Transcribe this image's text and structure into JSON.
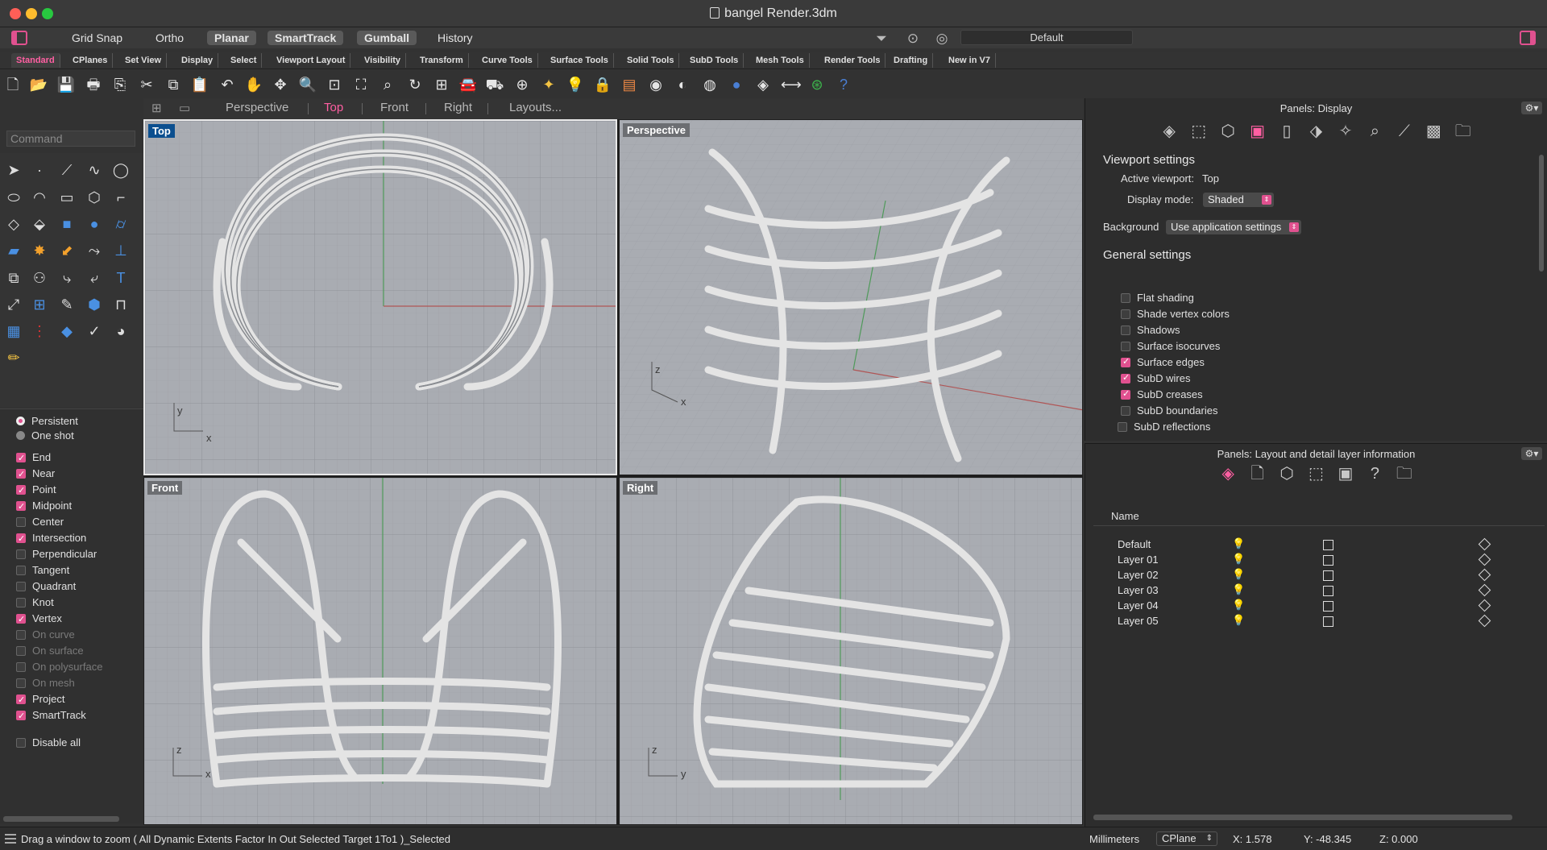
{
  "window": {
    "title": "bangel  Render.3dm"
  },
  "modebar": {
    "buttons": [
      "Grid Snap",
      "Ortho",
      "Planar",
      "SmartTrack",
      "Gumball",
      "History"
    ],
    "default_label": "Default"
  },
  "tabs": [
    "Standard",
    "CPlanes",
    "Set View",
    "Display",
    "Select",
    "Viewport Layout",
    "Visibility",
    "Transform",
    "Curve Tools",
    "Surface Tools",
    "Solid Tools",
    "SubD Tools",
    "Mesh Tools",
    "Render Tools",
    "Drafting",
    "New in V7"
  ],
  "command": {
    "placeholder": "Command"
  },
  "viewtabs": [
    "Perspective",
    "Top",
    "Front",
    "Right",
    "Layouts..."
  ],
  "viewports": {
    "top": "Top",
    "perspective": "Perspective",
    "front": "Front",
    "right": "Right"
  },
  "axes": {
    "y": "y",
    "x": "x",
    "z": "z"
  },
  "osnap": {
    "persistent": "Persistent",
    "oneshot": "One shot",
    "items": [
      {
        "label": "End",
        "on": true
      },
      {
        "label": "Near",
        "on": true
      },
      {
        "label": "Point",
        "on": true
      },
      {
        "label": "Midpoint",
        "on": true
      },
      {
        "label": "Center",
        "on": false
      },
      {
        "label": "Intersection",
        "on": true
      },
      {
        "label": "Perpendicular",
        "on": false
      },
      {
        "label": "Tangent",
        "on": false
      },
      {
        "label": "Quadrant",
        "on": false
      },
      {
        "label": "Knot",
        "on": false
      },
      {
        "label": "Vertex",
        "on": true
      },
      {
        "label": "On curve",
        "on": false
      },
      {
        "label": "On surface",
        "on": false
      },
      {
        "label": "On polysurface",
        "on": false
      },
      {
        "label": "On mesh",
        "on": false
      },
      {
        "label": "Project",
        "on": true
      },
      {
        "label": "SmartTrack",
        "on": true
      }
    ],
    "disable_all": "Disable all"
  },
  "display_panel": {
    "title": "Panels: Display",
    "viewport_settings": "Viewport settings",
    "active_viewport_label": "Active viewport:",
    "active_viewport_value": "Top",
    "display_mode_label": "Display mode:",
    "display_mode_value": "Shaded",
    "background_label": "Background",
    "background_value": "Use application settings",
    "general_settings": "General settings",
    "settings": [
      {
        "label": "Flat shading",
        "on": false
      },
      {
        "label": "Shade vertex colors",
        "on": false
      },
      {
        "label": "Shadows",
        "on": false
      },
      {
        "label": "Surface isocurves",
        "on": false
      },
      {
        "label": "Surface edges",
        "on": true
      },
      {
        "label": "SubD wires",
        "on": true
      },
      {
        "label": "SubD creases",
        "on": true
      },
      {
        "label": "SubD boundaries",
        "on": false
      },
      {
        "label": "SubD reflections",
        "on": false
      }
    ]
  },
  "layer_panel": {
    "title": "Panels: Layout and detail layer information",
    "name_col": "Name",
    "layers": [
      "Default",
      "Layer 01",
      "Layer 02",
      "Layer 03",
      "Layer 04",
      "Layer 05"
    ]
  },
  "statusbar": {
    "message": "Drag a window to zoom ( All Dynamic Extents Factor In Out Selected Target 1To1 )_Selected",
    "units": "Millimeters",
    "cplane": "CPlane",
    "x": "X: 1.578",
    "y": "Y: -48.345",
    "z": "Z: 0.000"
  },
  "colors": {
    "accent": "#e0518f",
    "viewport_bg": "#a9acb2",
    "active_label": "#0b4f8f"
  }
}
